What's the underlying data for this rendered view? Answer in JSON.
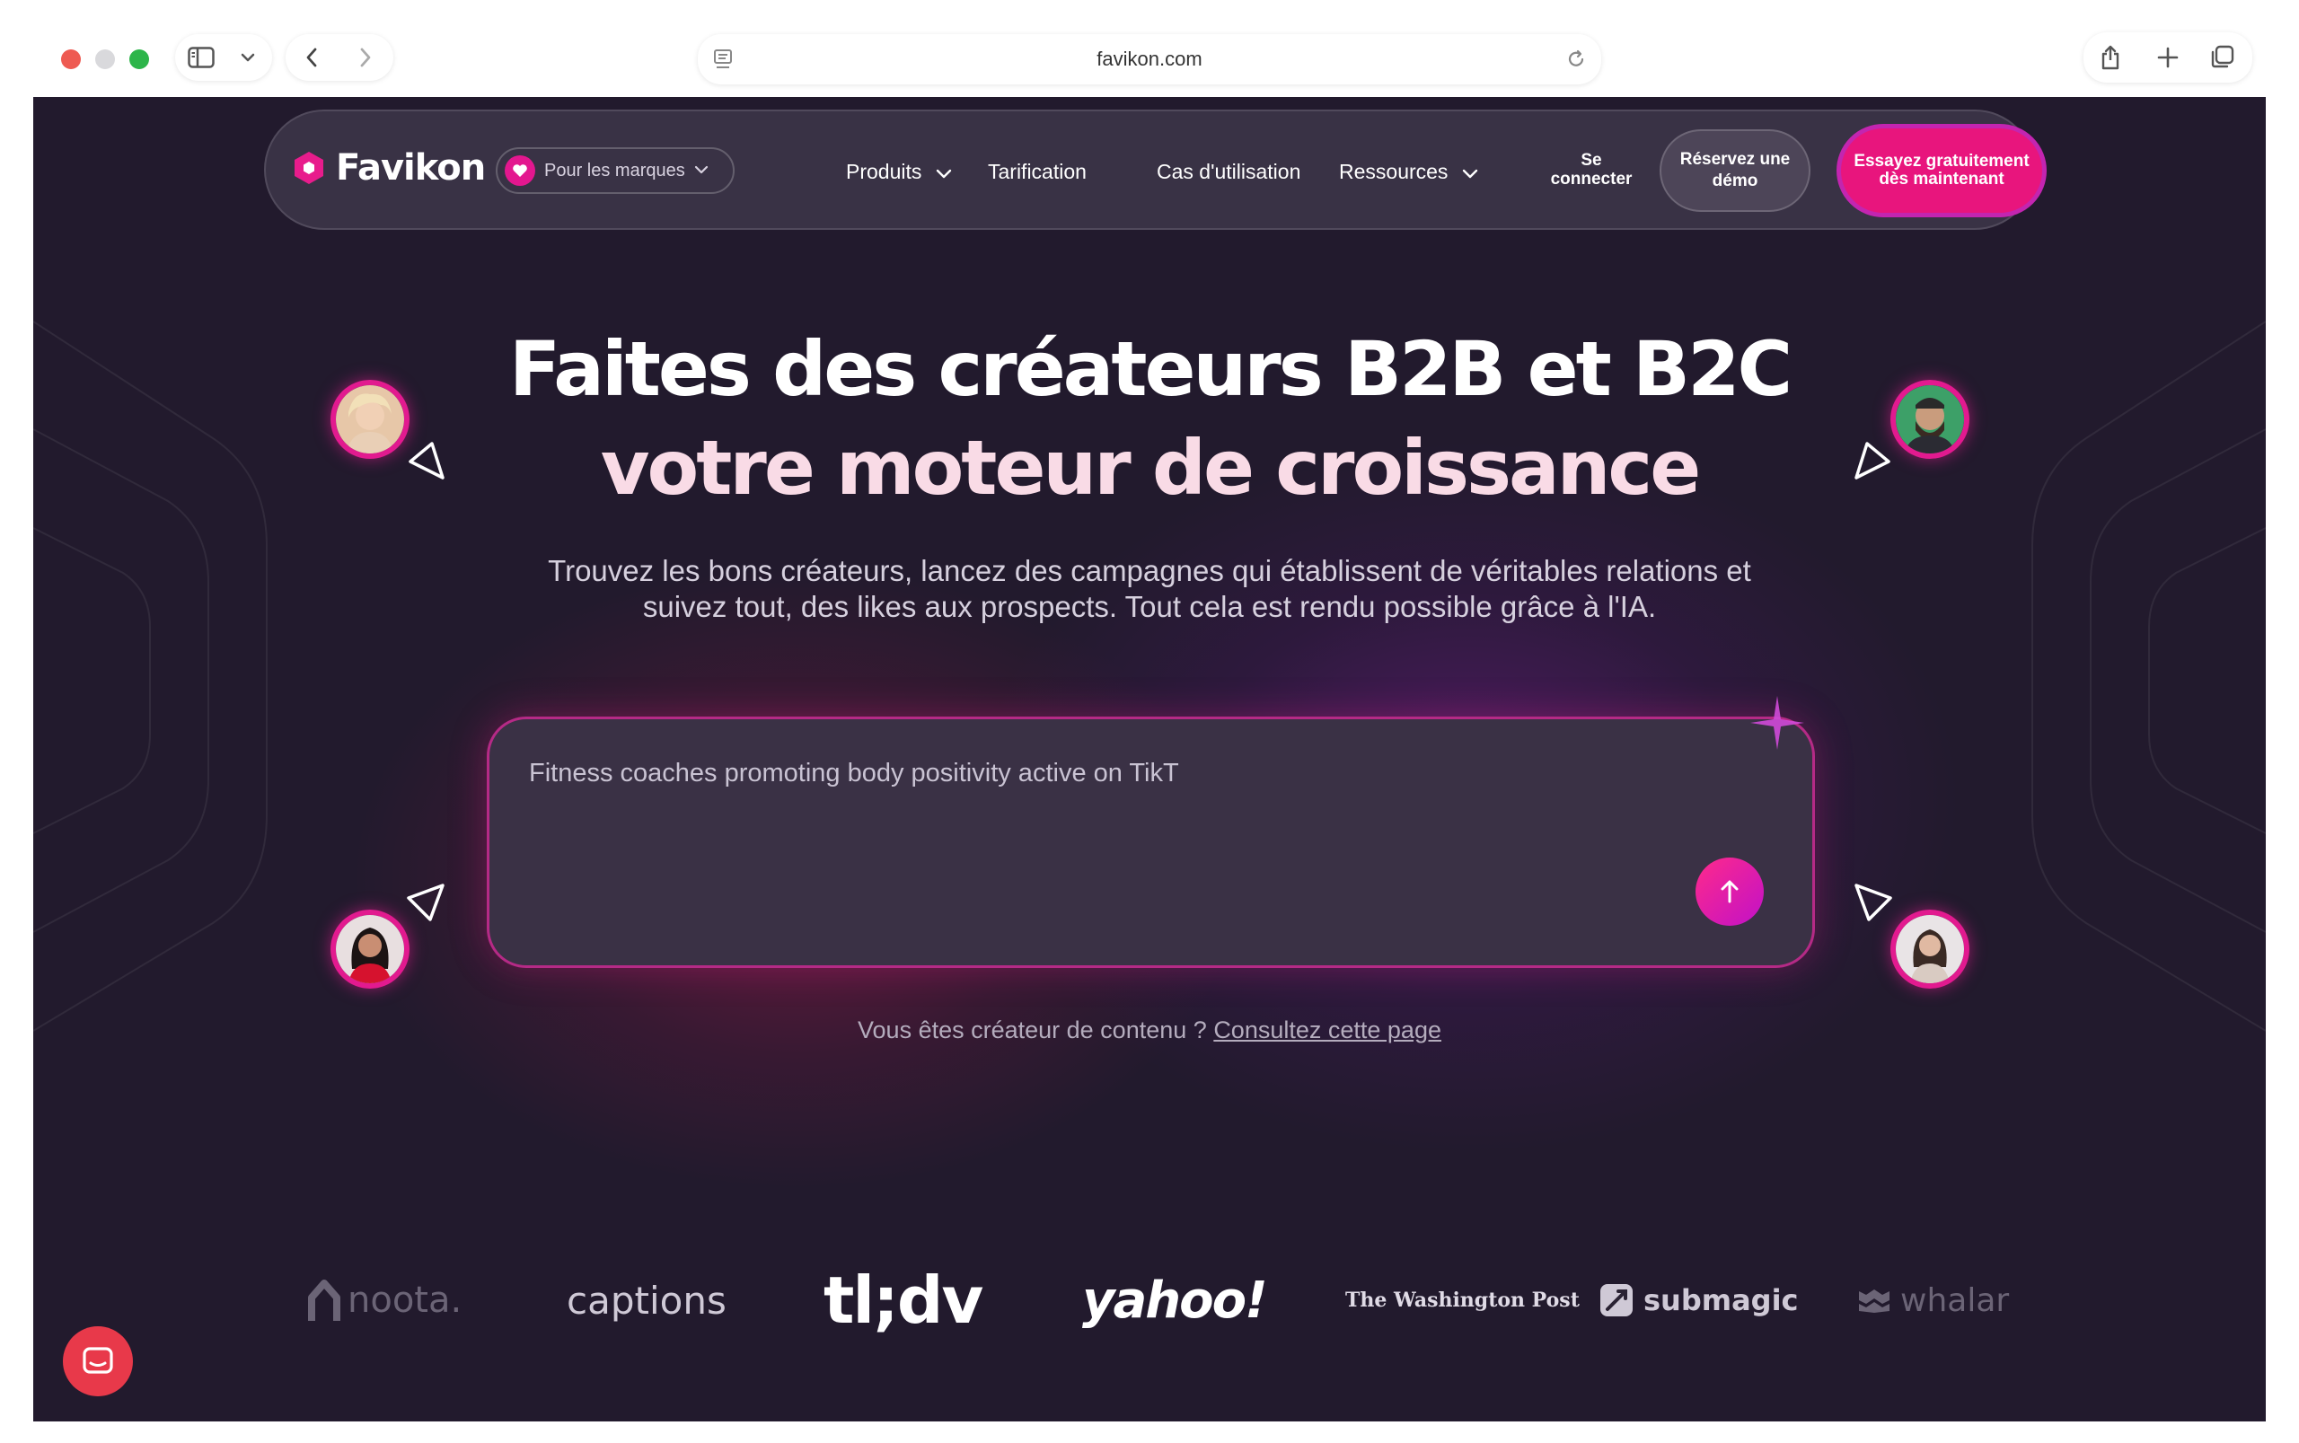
{
  "browser": {
    "url": "favikon.com"
  },
  "nav": {
    "logo_text": "Favikon",
    "audience_selector": "Pour les marques",
    "links": {
      "products": "Produits",
      "pricing": "Tarification",
      "use_cases": "Cas d'utilisation",
      "resources": "Ressources"
    },
    "login": "Se connecter",
    "demo": "Réservez une démo",
    "try_free": "Essayez gratuitement dès maintenant"
  },
  "hero": {
    "headline_line1": "Faites des créateurs B2B et B2C",
    "headline_line2": "votre moteur de croissance",
    "subtitle": "Trouvez les bons créateurs, lancez des campagnes qui établissent de véritables relations et suivez tout, des likes aux prospects. Tout cela est rendu possible grâce à l'IA.",
    "search_value": "Fitness coaches promoting body positivity active on TikT",
    "creator_prompt": "Vous êtes créateur de contenu ?",
    "creator_link": "Consultez cette page"
  },
  "logos": [
    "noota.",
    "captions",
    "tl;dv",
    "yahoo!",
    "The Washington Post",
    "submagic",
    "whalar"
  ],
  "colors": {
    "background": "#221a2d",
    "accent_pink": "#e8157d",
    "accent_purple": "#c325b0"
  }
}
